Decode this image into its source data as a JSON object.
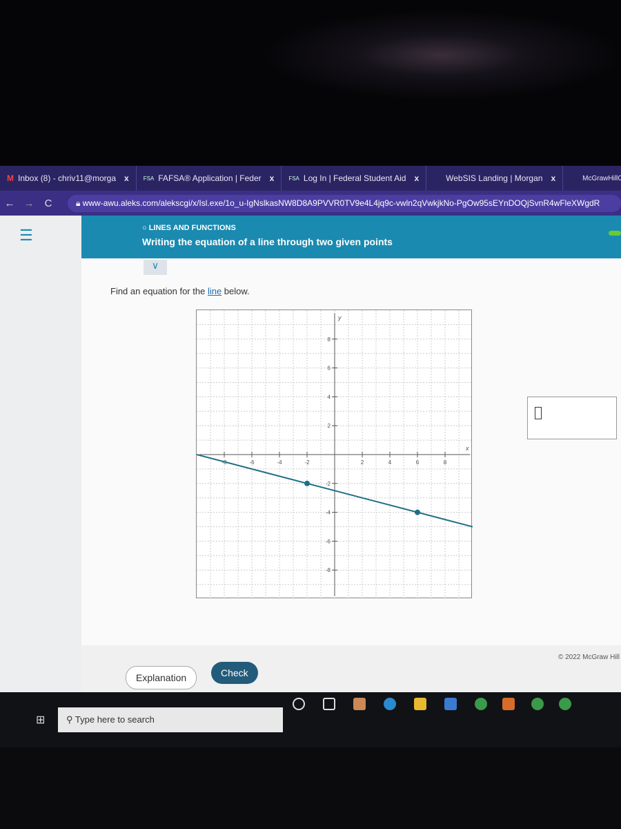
{
  "browser": {
    "tabs": [
      {
        "label": "Inbox (8) - chriv11@morga",
        "icon": "gmail-icon"
      },
      {
        "label": "FAFSA® Application | Feder",
        "icon": "fsa-icon"
      },
      {
        "label": "Log In | Federal Student Aid",
        "icon": "fsa-icon"
      },
      {
        "label": "WebSIS Landing | Morgan",
        "icon": "page-icon"
      },
      {
        "label": "McGrawHillCampus_",
        "icon": "page-icon"
      }
    ],
    "close_glyph": "x",
    "url": "www-awu.aleks.com/alekscgi/x/Isl.exe/1o_u-IgNslkasNW8D8A9PVVR0TV9e4L4jq9c-vwln2qVwkjkNo-PgOw95sEYnDOQjSvnR4wFleXWgdR"
  },
  "header": {
    "topic": "LINES AND FUNCTIONS",
    "title": "Writing the equation of a line through two given points",
    "menu_glyph": "☰"
  },
  "question": {
    "prefix": "Find an equation for the ",
    "link": "line",
    "suffix": " below."
  },
  "chart_data": {
    "type": "line",
    "xlabel": "x",
    "ylabel": "y",
    "xlim": [
      -10,
      10
    ],
    "ylim": [
      -10,
      10
    ],
    "x_ticks": [
      -8,
      -6,
      -4,
      -2,
      2,
      4,
      6,
      8
    ],
    "y_ticks": [
      8,
      6,
      4,
      2,
      -2,
      -4,
      -6,
      -8
    ],
    "grid": true,
    "points": [
      {
        "x": -2,
        "y": -2
      },
      {
        "x": 6,
        "y": -4
      }
    ],
    "color": "#1f6f86"
  },
  "footer": {
    "explanation": "Explanation",
    "check": "Check",
    "copyright": "© 2022 McGraw Hill"
  },
  "taskbar": {
    "search_placeholder": "Type here to search"
  }
}
